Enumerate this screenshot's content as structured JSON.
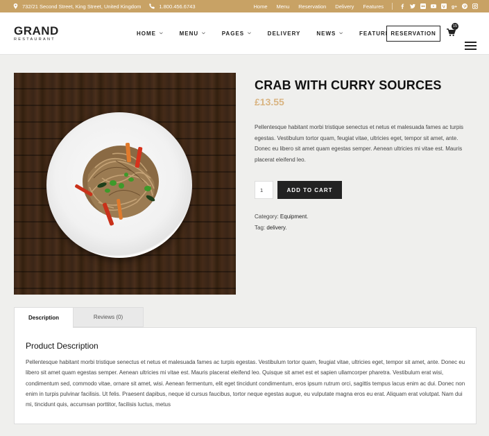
{
  "topbar": {
    "address": "732/21 Second Street, King Street, United Kingdom",
    "phone": "1.800.456.6743",
    "links": [
      "Home",
      "Menu",
      "Reservation",
      "Delivery",
      "Features"
    ],
    "social_icons": [
      "facebook-icon",
      "twitter-icon",
      "flickr-icon",
      "youtube-icon",
      "vimeo-icon",
      "google-plus-icon",
      "pinterest-icon",
      "instagram-icon"
    ],
    "color": "#c8a265"
  },
  "header": {
    "logo_main": "GRAND",
    "logo_sub": "RESTAURANT",
    "nav": [
      {
        "label": "HOME",
        "has_dropdown": true
      },
      {
        "label": "MENU",
        "has_dropdown": true
      },
      {
        "label": "PAGES",
        "has_dropdown": true
      },
      {
        "label": "DELIVERY",
        "has_dropdown": false
      },
      {
        "label": "NEWS",
        "has_dropdown": true
      },
      {
        "label": "FEATURES",
        "has_dropdown": true
      }
    ],
    "reservation_label": "RESERVATION",
    "cart_count": "15"
  },
  "product": {
    "title": "CRAB WITH CURRY SOURCES",
    "price": "£13.55",
    "price_color": "#d9b481",
    "description": "Pellentesque habitant morbi tristique senectus et netus et malesuada fames ac turpis egestas. Vestibulum tortor quam, feugiat vitae, ultricies eget, tempor sit amet, ante. Donec eu libero sit amet quam egestas semper. Aenean ultricies mi vitae est. Mauris placerat eleifend leo.",
    "quantity": "1",
    "add_to_cart_label": "ADD TO CART",
    "category_label": "Category:",
    "category_value": "Equipment",
    "tag_label": "Tag:",
    "tag_value": "delivery"
  },
  "tabs": [
    {
      "label": "Description",
      "active": true
    },
    {
      "label": "Reviews (0)",
      "active": false
    }
  ],
  "description_panel": {
    "title": "Product Description",
    "body": "Pellentesque habitant morbi tristique senectus et netus et malesuada fames ac turpis egestas. Vestibulum tortor quam, feugiat vitae, ultricies eget, tempor sit amet, ante. Donec eu libero sit amet quam egestas semper. Aenean ultricies mi vitae est. Mauris placerat eleifend leo. Quisque sit amet est et sapien ullamcorper pharetra. Vestibulum erat wisi, condimentum sed, commodo vitae, ornare sit amet, wisi. Aenean fermentum, elit eget tincidunt condimentum, eros ipsum rutrum orci, sagittis tempus lacus enim ac dui. Donec non enim in turpis pulvinar facilisis. Ut felis. Praesent dapibus, neque id cursus faucibus, tortor neque egestas augue, eu vulputate magna eros eu erat. Aliquam erat volutpat. Nam dui mi, tincidunt quis, accumsan porttitor, facilisis luctus, metus"
  }
}
